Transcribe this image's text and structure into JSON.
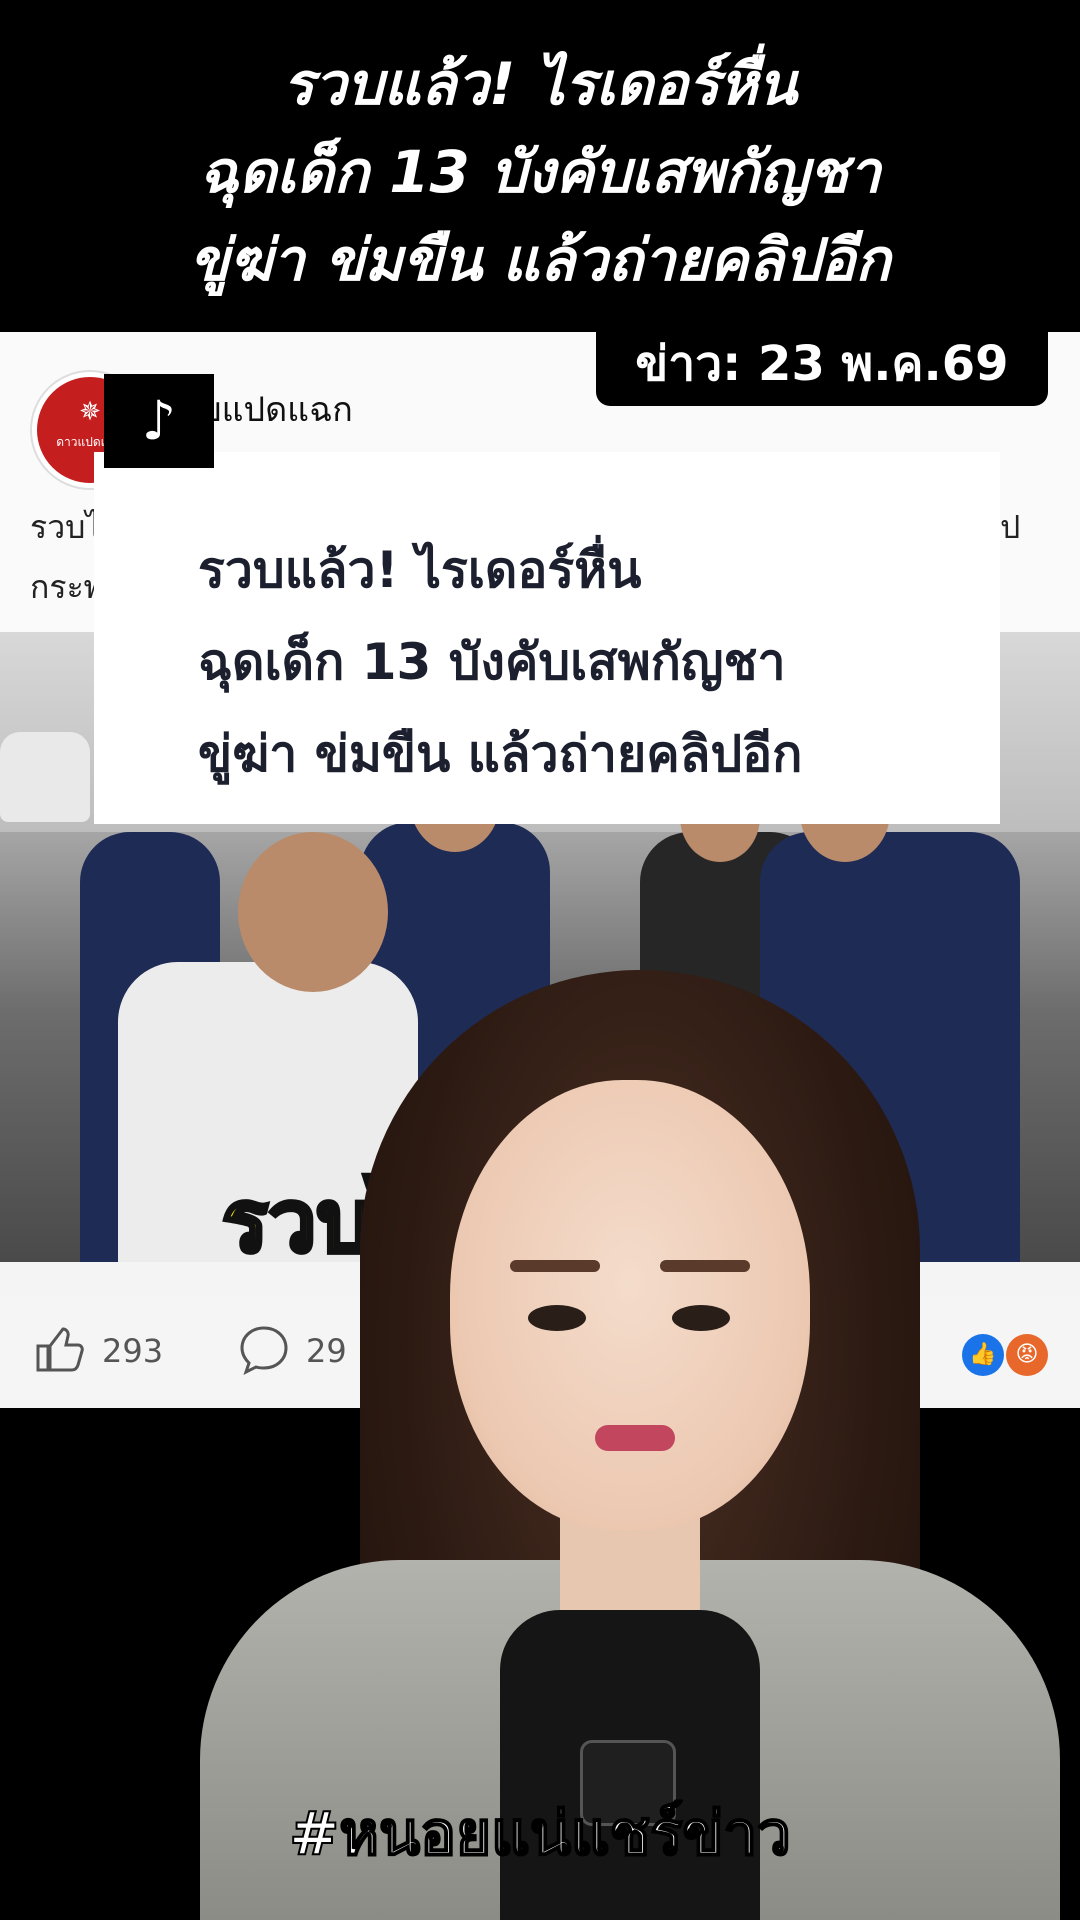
{
  "headline": {
    "lines": [
      "รวบแล้ว! ไรเดอร์หื่น",
      "ฉุดเด็ก 13 บังคับเสพกัญชา",
      "ขู่ฆ่า ข่มขืน แล้วถ่ายคลิปอีก"
    ]
  },
  "date_badge": "ข่าว: 23 พ.ค.69",
  "post": {
    "page_name": "บแปดแฉก",
    "avatar_text": "ดาวแปดแฉก",
    "text_line_1": "รวบไ",
    "text_line_2": "กระพ",
    "text_right": "ป",
    "overlay_lines": [
      "รวบแล้ว! ไรเดอร์หื่น",
      "ฉุดเด็ก 13 บังคับเสพกัญชา",
      "ขู่ฆ่า ข่มขืน แล้วถ่ายคลิปอีก"
    ],
    "photo_caption": "รวบไ          น",
    "likes": "293",
    "comments": "29"
  },
  "hashtag": "#หนอยแน่แชร์ข่าว",
  "icons": {
    "tiktok": "tiktok-logo-icon",
    "like": "thumbs-up-icon",
    "comment": "comment-bubble-icon",
    "react_like": "like-reaction-icon",
    "react_angry": "angry-reaction-icon"
  },
  "colors": {
    "banner": "#000000",
    "caption_yellow": "#f3e312",
    "like_blue": "#1a73e8",
    "angry_orange": "#e8672a"
  }
}
